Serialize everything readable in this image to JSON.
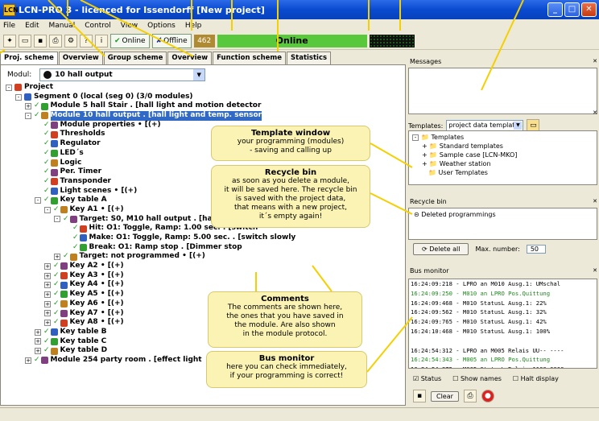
{
  "window": {
    "title": "LCN-PRO 3 - licenced for Issendorff [New project]"
  },
  "menu": [
    "File",
    "Edit",
    "Manual",
    "Control",
    "View",
    "Options",
    "Help"
  ],
  "toolbar": {
    "online": "Online",
    "offline": "Offline",
    "count": "462",
    "status": "Online"
  },
  "tabs": [
    "Proj. scheme",
    "Overview",
    "Group scheme",
    "Overview",
    "Function scheme",
    "Statistics"
  ],
  "modul": {
    "label": "Modul:",
    "value": "10 hall output"
  },
  "tree": [
    {
      "t": "Project",
      "d": 0,
      "exp": "-"
    },
    {
      "t": "Segment 0 (local (seg 0) (3/0 modules)",
      "d": 1,
      "exp": "-"
    },
    {
      "t": "Module 5 hall Stair  .  [hall light and motion detector",
      "d": 2,
      "exp": "+"
    },
    {
      "t": "Module 10 hall output  .  [hall light and temp. sensor",
      "d": 2,
      "exp": "-",
      "sel": true
    },
    {
      "t": "Module properties  • [(+)",
      "d": 3
    },
    {
      "t": "Thresholds",
      "d": 3
    },
    {
      "t": "Regulator",
      "d": 3
    },
    {
      "t": "LED´s",
      "d": 3
    },
    {
      "t": "Logic",
      "d": 3
    },
    {
      "t": "Per. Timer",
      "d": 3
    },
    {
      "t": "Transponder",
      "d": 3
    },
    {
      "t": "Light scenes  • [(+)",
      "d": 3
    },
    {
      "t": "Key table  A",
      "d": 3,
      "exp": "-"
    },
    {
      "t": "Key  A1  • [(+)",
      "d": 4,
      "exp": "-"
    },
    {
      "t": "Target: S0,  M10 hall output . [hall light",
      "d": 5,
      "exp": "-"
    },
    {
      "t": "Hit: O1: Toggle, Ramp: 1.00 sec.  . [switch",
      "d": 6
    },
    {
      "t": "Make: O1: Toggle, Ramp: 5.00 sec.  . [switch slowly",
      "d": 6
    },
    {
      "t": "Break: O1: Ramp stop  . [Dimmer stop",
      "d": 6
    },
    {
      "t": "Target:  not programmed  • [(+)",
      "d": 5,
      "exp": "+"
    },
    {
      "t": "Key  A2  • [(+)",
      "d": 4,
      "exp": "+"
    },
    {
      "t": "Key  A3  • [(+)",
      "d": 4,
      "exp": "+"
    },
    {
      "t": "Key  A4  • [(+)",
      "d": 4,
      "exp": "+"
    },
    {
      "t": "Key  A5  • [(+)",
      "d": 4,
      "exp": "+"
    },
    {
      "t": "Key  A6  • [(+)",
      "d": 4,
      "exp": "+"
    },
    {
      "t": "Key  A7  • [(+)",
      "d": 4,
      "exp": "+"
    },
    {
      "t": "Key  A8  • [(+)",
      "d": 4,
      "exp": "+"
    },
    {
      "t": "Key table  B",
      "d": 3,
      "exp": "+"
    },
    {
      "t": "Key table  C",
      "d": 3,
      "exp": "+"
    },
    {
      "t": "Key table  D",
      "d": 3,
      "exp": "+"
    },
    {
      "t": "Module 254 party room  .  [effect light",
      "d": 2,
      "exp": "+"
    }
  ],
  "callouts": {
    "template": {
      "title": "Template window",
      "body": "your programming (modules)\n- saving and calling up"
    },
    "recycle": {
      "title": "Recycle bin",
      "body": "as soon as you delete a module,\nit will be saved here. The recycle bin\nis saved with the project data,\nthat means with a new project,\nit´s empty again!"
    },
    "comments": {
      "title": "Comments",
      "body": "The comments are shown here,\nthe ones that you have saved in\nthe module. Are also shown\nin the module protocol."
    },
    "bus": {
      "title": "Bus monitor",
      "body": "here you can check immediately,\nif your programming is correct!"
    }
  },
  "right": {
    "messages": "Messages",
    "templates_label": "Templates:",
    "templates_value": "project data templates",
    "template_tree": [
      "Templates",
      "Standard templates",
      "Sample case [LCN-MKO]",
      "Weather station",
      "User Templates"
    ],
    "recycle": "Recycle bin",
    "recycle_item": "Deleted programmings",
    "delete_all": "Delete all",
    "max_label": "Max. number:",
    "max_value": "50",
    "bus": "Bus monitor",
    "log": [
      {
        "t": "16:24:09:218 - LPRO an M010 Ausg.1: UMschal",
        "c": ""
      },
      {
        "t": "16:24:09:250 - M010 an LPRO Pos.Quittung",
        "c": "green"
      },
      {
        "t": "16:24:09:468 - M010 StatusL Ausg.1: 22%",
        "c": ""
      },
      {
        "t": "16:24:09:562 - M010 StatusL Ausg.1: 32%",
        "c": ""
      },
      {
        "t": "16:24:09:765 - M010 StatusL Ausg.1: 42%",
        "c": ""
      },
      {
        "t": "16:24:10:468 - M010 StatusL Ausg.1: 100%",
        "c": ""
      },
      {
        "t": "",
        "c": ""
      },
      {
        "t": "16:24:54:312 - LPRO an M005 Relais UU-- ----",
        "c": ""
      },
      {
        "t": "16:24:54:343 - M005 an LPRO Pos.Quittung",
        "c": "green"
      },
      {
        "t": "16:24:54:375 - M005 StatusL Relais 1100 0000",
        "c": ""
      }
    ],
    "status": "Status",
    "show_names": "Show names",
    "halt": "Halt display",
    "clear": "Clear"
  }
}
